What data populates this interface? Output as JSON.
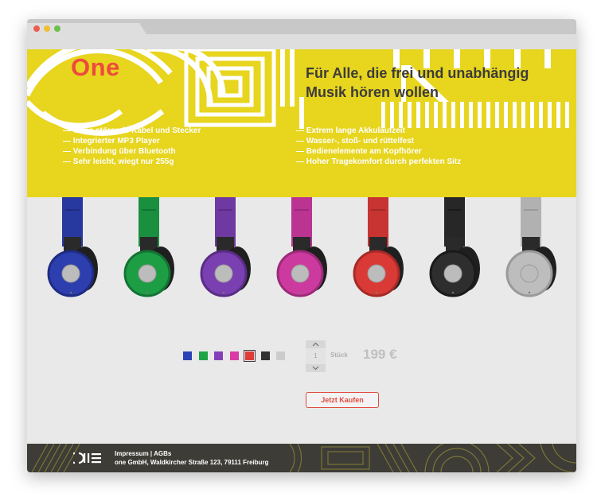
{
  "brand": {
    "name": "One",
    "accent": "#ee4a3d",
    "hero_color": "#e7d51e"
  },
  "headline": {
    "line1": "Für Alle, die frei und unabhängig",
    "line2": "Musik hören wollen"
  },
  "features_left": [
    "— Ohne störende Kabel und Stecker",
    "— Integrierter MP3 Player",
    "— Verbindung über Bluetooth",
    "— Sehr leicht, wiegt nur 255g"
  ],
  "features_right": [
    "— Extrem lange Akkulaufzeit",
    "— Wasser-, stoß- und rüttelfest",
    "— Bedienelemente am Kopfhörer",
    "— Hoher Tragekomfort durch perfekten Sitz"
  ],
  "products": [
    {
      "color": "#2d3fae",
      "dark": "#1e2c82",
      "name": "blue"
    },
    {
      "color": "#1d9e45",
      "dark": "#137433",
      "name": "green"
    },
    {
      "color": "#7a3fb0",
      "dark": "#5a2d86",
      "name": "purple"
    },
    {
      "color": "#cc3aa0",
      "dark": "#9c2a79",
      "name": "pink"
    },
    {
      "color": "#d93a36",
      "dark": "#a62a27",
      "name": "red"
    },
    {
      "color": "#2e2e2e",
      "dark": "#1a1a1a",
      "name": "black"
    },
    {
      "color": "#bdbdbd",
      "dark": "#9a9a9a",
      "name": "silver"
    }
  ],
  "swatches": [
    {
      "color": "#2b41b5",
      "name": "blue",
      "selected": false
    },
    {
      "color": "#1da548",
      "name": "green",
      "selected": false
    },
    {
      "color": "#8440b8",
      "name": "purple",
      "selected": false
    },
    {
      "color": "#db3aa6",
      "name": "pink",
      "selected": false
    },
    {
      "color": "#e03b37",
      "name": "red",
      "selected": true
    },
    {
      "color": "#333333",
      "name": "black",
      "selected": false
    },
    {
      "color": "#cccccc",
      "name": "silver",
      "selected": false
    }
  ],
  "quantity": {
    "value": "1",
    "unit_label": "Stück",
    "up_icon": "chevron-up-icon",
    "down_icon": "chevron-down-icon"
  },
  "price": "199 €",
  "buy_button": "Jetzt Kaufen",
  "footer": {
    "logo_text": "ONE",
    "link_impressum": "Impressum",
    "separator": " | ",
    "link_agbs": "AGBs",
    "address": "one GmbH, Waldkircher Straße 123, 79111 Freiburg"
  }
}
